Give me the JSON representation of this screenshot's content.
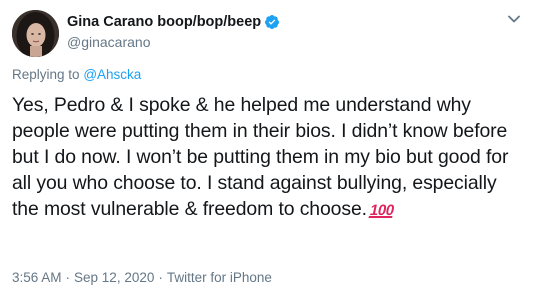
{
  "author": {
    "display_name": "Gina Carano boop/bop/beep",
    "handle": "@ginacarano",
    "verified": true
  },
  "reply": {
    "prefix": "Replying to",
    "mention": "@Ahscka"
  },
  "tweet": {
    "text": "Yes, Pedro & I spoke & he helped me understand why people were putting them in their bios. I didn’t know before but I do now. I won’t be putting them in my bio but good for all you who choose to. I stand against bullying, especially the most vulnerable & freedom to choose.",
    "emoji": "💯"
  },
  "meta": {
    "time": "3:56 AM",
    "separator": "·",
    "date": "Sep 12, 2020",
    "source": "Twitter for iPhone"
  },
  "icons": {
    "verified": "verified-badge-icon",
    "more": "chevron-down-icon",
    "hundred": "hundred-points-icon"
  },
  "colors": {
    "accent": "#1da1f2",
    "secondary_text": "#657786",
    "primary_text": "#14171a",
    "emoji_red": "#e0245e"
  }
}
